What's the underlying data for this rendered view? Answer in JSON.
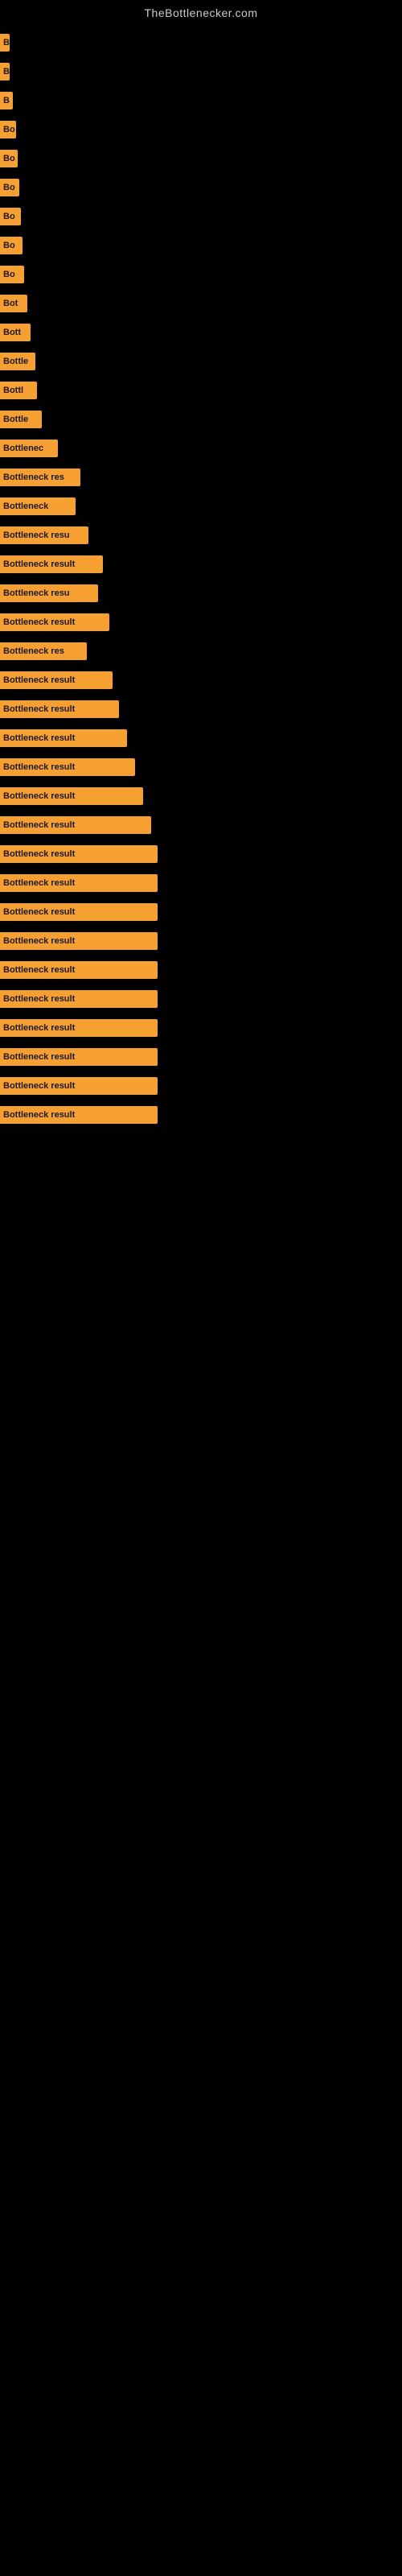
{
  "site": {
    "title": "TheBottlenecker.com"
  },
  "bars": [
    {
      "id": 1,
      "width": 12,
      "label": "B"
    },
    {
      "id": 2,
      "width": 12,
      "label": "B"
    },
    {
      "id": 3,
      "width": 16,
      "label": "B"
    },
    {
      "id": 4,
      "width": 20,
      "label": "Bo"
    },
    {
      "id": 5,
      "width": 22,
      "label": "Bo"
    },
    {
      "id": 6,
      "width": 24,
      "label": "Bo"
    },
    {
      "id": 7,
      "width": 26,
      "label": "Bo"
    },
    {
      "id": 8,
      "width": 28,
      "label": "Bo"
    },
    {
      "id": 9,
      "width": 30,
      "label": "Bo"
    },
    {
      "id": 10,
      "width": 34,
      "label": "Bot"
    },
    {
      "id": 11,
      "width": 38,
      "label": "Bott"
    },
    {
      "id": 12,
      "width": 44,
      "label": "Bottle"
    },
    {
      "id": 13,
      "width": 46,
      "label": "Bottl"
    },
    {
      "id": 14,
      "width": 52,
      "label": "Bottle"
    },
    {
      "id": 15,
      "width": 72,
      "label": "Bottlenec"
    },
    {
      "id": 16,
      "width": 100,
      "label": "Bottleneck res"
    },
    {
      "id": 17,
      "width": 94,
      "label": "Bottleneck"
    },
    {
      "id": 18,
      "width": 110,
      "label": "Bottleneck resu"
    },
    {
      "id": 19,
      "width": 128,
      "label": "Bottleneck result"
    },
    {
      "id": 20,
      "width": 122,
      "label": "Bottleneck resu"
    },
    {
      "id": 21,
      "width": 136,
      "label": "Bottleneck result"
    },
    {
      "id": 22,
      "width": 108,
      "label": "Bottleneck res"
    },
    {
      "id": 23,
      "width": 140,
      "label": "Bottleneck result"
    },
    {
      "id": 24,
      "width": 148,
      "label": "Bottleneck result"
    },
    {
      "id": 25,
      "width": 158,
      "label": "Bottleneck result"
    },
    {
      "id": 26,
      "width": 168,
      "label": "Bottleneck result"
    },
    {
      "id": 27,
      "width": 178,
      "label": "Bottleneck result"
    },
    {
      "id": 28,
      "width": 188,
      "label": "Bottleneck result"
    },
    {
      "id": 29,
      "width": 196,
      "label": "Bottleneck result"
    },
    {
      "id": 30,
      "width": 196,
      "label": "Bottleneck result"
    },
    {
      "id": 31,
      "width": 196,
      "label": "Bottleneck result"
    },
    {
      "id": 32,
      "width": 196,
      "label": "Bottleneck result"
    },
    {
      "id": 33,
      "width": 196,
      "label": "Bottleneck result"
    },
    {
      "id": 34,
      "width": 196,
      "label": "Bottleneck result"
    },
    {
      "id": 35,
      "width": 196,
      "label": "Bottleneck result"
    },
    {
      "id": 36,
      "width": 196,
      "label": "Bottleneck result"
    },
    {
      "id": 37,
      "width": 196,
      "label": "Bottleneck result"
    },
    {
      "id": 38,
      "width": 196,
      "label": "Bottleneck result"
    }
  ]
}
